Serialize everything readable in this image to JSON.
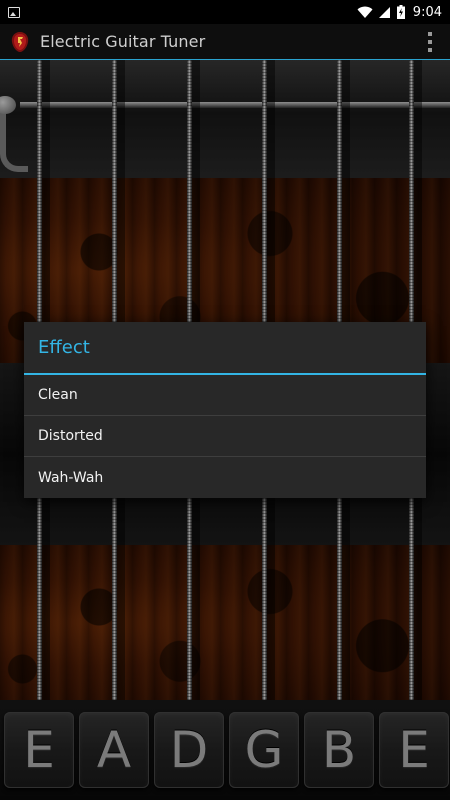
{
  "status_bar": {
    "time": "9:04",
    "icons": [
      "image-notification-icon",
      "wifi-icon",
      "signal-icon",
      "battery-charging-icon"
    ]
  },
  "action_bar": {
    "title": "Electric Guitar Tuner",
    "app_icon": "guitar-app-icon",
    "overflow_icon": "overflow-menu-icon"
  },
  "dialog": {
    "title": "Effect",
    "items": [
      {
        "label": "Clean"
      },
      {
        "label": "Distorted"
      },
      {
        "label": "Wah-Wah"
      }
    ]
  },
  "tuner": {
    "notes": [
      "E",
      "A",
      "D",
      "G",
      "B",
      "E"
    ]
  },
  "colors": {
    "accent": "#33b5e5",
    "dialog_bg": "#282828",
    "action_bar_bg": "#0e0e0e"
  }
}
